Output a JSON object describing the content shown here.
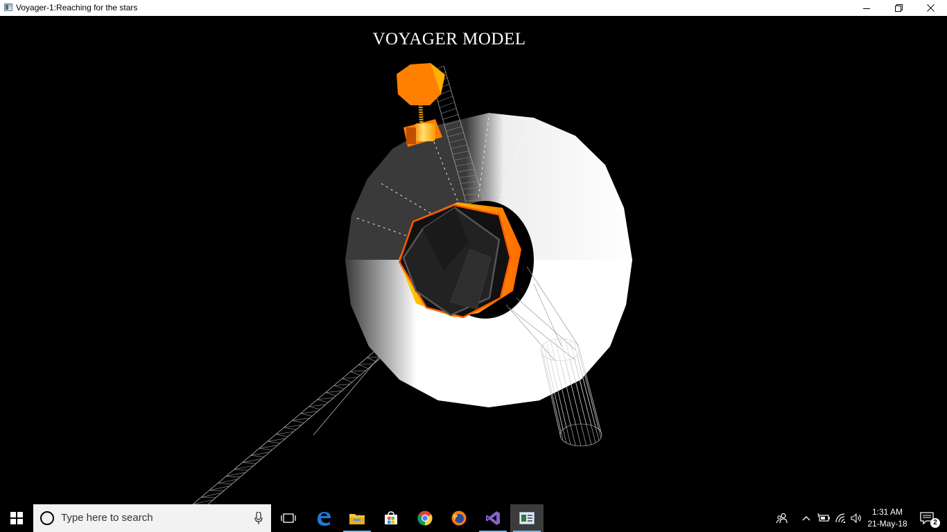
{
  "window": {
    "title": "Voyager-1:Reaching for the stars",
    "controls": [
      "minimize",
      "restore",
      "close"
    ]
  },
  "scene": {
    "title": "VOYAGER MODEL",
    "colors": {
      "background": "#000000",
      "dish": "#ffffff",
      "dish_shadow": "#333333",
      "bus": "#2a2a2a",
      "accent": "#ff7a00",
      "gold": "#ffb800",
      "wireframe": "#cccccc"
    }
  },
  "taskbar": {
    "search_placeholder": "Type here to search",
    "apps": [
      {
        "icon": "task-view-icon"
      },
      {
        "icon": "edge-icon"
      },
      {
        "icon": "file-explorer-icon"
      },
      {
        "icon": "store-icon"
      },
      {
        "icon": "chrome-icon"
      },
      {
        "icon": "firefox-icon"
      },
      {
        "icon": "visual-studio-icon"
      },
      {
        "icon": "voyager-app-icon"
      }
    ],
    "clock": {
      "time": "1:31 AM",
      "date": "21-May-18"
    },
    "notification_count": "2"
  }
}
